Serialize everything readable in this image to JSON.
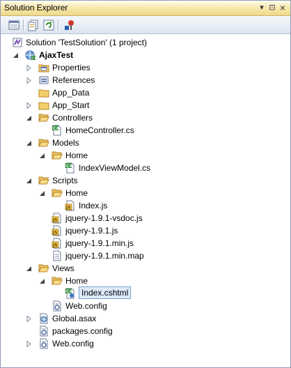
{
  "window": {
    "title": "Solution Explorer",
    "pin_glyph": "▾",
    "autohide_glyph": "⊡",
    "close_glyph": "×"
  },
  "toolbar": {
    "buttons": [
      {
        "icon": "properties-icon"
      },
      {
        "icon": "show-all-files-icon"
      },
      {
        "icon": "refresh-icon"
      },
      {
        "icon": "view-class-diagram-icon"
      }
    ]
  },
  "tree": {
    "solution_label": "Solution 'TestSolution' (1 project)",
    "project_label": "AjaxTest",
    "items": [
      {
        "label": "Properties",
        "icon": "properties-folder-icon",
        "state": "collapsed"
      },
      {
        "label": "References",
        "icon": "references-icon",
        "state": "collapsed"
      },
      {
        "label": "App_Data",
        "icon": "folder-icon",
        "state": "none"
      },
      {
        "label": "App_Start",
        "icon": "folder-icon",
        "state": "collapsed"
      },
      {
        "label": "Controllers",
        "icon": "folder-open-icon",
        "state": "expanded"
      },
      {
        "label": "HomeController.cs",
        "icon": "csharp-file-icon",
        "state": "none"
      },
      {
        "label": "Models",
        "icon": "folder-open-icon",
        "state": "expanded"
      },
      {
        "label": "Home",
        "icon": "folder-open-icon",
        "state": "expanded"
      },
      {
        "label": "IndexViewModel.cs",
        "icon": "csharp-file-icon",
        "state": "none"
      },
      {
        "label": "Scripts",
        "icon": "folder-open-icon",
        "state": "expanded"
      },
      {
        "label": "Home",
        "icon": "folder-open-icon",
        "state": "expanded"
      },
      {
        "label": "Index.js",
        "icon": "js-file-icon",
        "state": "none"
      },
      {
        "label": "jquery-1.9.1-vsdoc.js",
        "icon": "js-file-icon",
        "state": "none"
      },
      {
        "label": "jquery-1.9.1.js",
        "icon": "js-file-icon",
        "state": "none"
      },
      {
        "label": "jquery-1.9.1.min.js",
        "icon": "js-file-icon",
        "state": "none"
      },
      {
        "label": "jquery-1.9.1.min.map",
        "icon": "text-file-icon",
        "state": "none"
      },
      {
        "label": "Views",
        "icon": "folder-open-icon",
        "state": "expanded"
      },
      {
        "label": "Home",
        "icon": "folder-open-icon",
        "state": "expanded"
      },
      {
        "label": "Index.cshtml",
        "icon": "cshtml-file-icon",
        "state": "selected"
      },
      {
        "label": "Web.config",
        "icon": "config-file-icon",
        "state": "none"
      },
      {
        "label": "Global.asax",
        "icon": "asax-file-icon",
        "state": "collapsed"
      },
      {
        "label": "packages.config",
        "icon": "config-file-icon",
        "state": "none"
      },
      {
        "label": "Web.config",
        "icon": "config-file-icon",
        "state": "collapsed"
      }
    ]
  },
  "colors": {
    "selection_fill": "#dceaf9",
    "selection_border": "#7da2ce",
    "titlebar": "#f7e9b0"
  }
}
